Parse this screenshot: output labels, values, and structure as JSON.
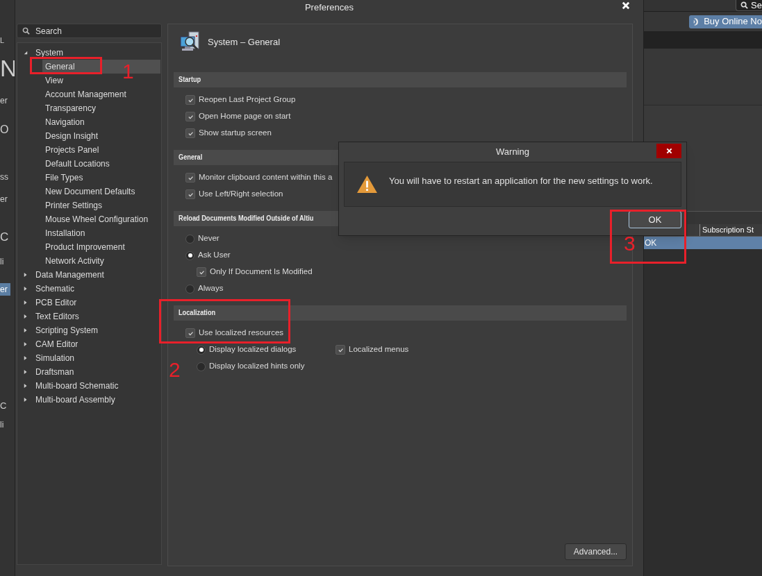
{
  "background_app": {
    "left_fragments": [
      {
        "text": "L",
        "selected": false
      },
      {
        "text": "N",
        "selected": false
      },
      {
        "text": "er",
        "selected": false
      },
      {
        "text": "O",
        "selected": false
      },
      {
        "text": "ss",
        "selected": false
      },
      {
        "text": "er",
        "selected": false
      },
      {
        "text": "C",
        "selected": false
      },
      {
        "text": "li",
        "selected": false
      },
      {
        "text": "er",
        "selected": true
      },
      {
        "text": "C",
        "selected": false
      },
      {
        "text": "li",
        "selected": false
      }
    ],
    "search": "Se",
    "buy_button": "Buy Online No",
    "table_header": "Subscription St",
    "table_cell": "OK"
  },
  "preferences": {
    "title": "Preferences",
    "search_placeholder": "Search",
    "tree": [
      {
        "label": "System",
        "expanded": true,
        "selected": false,
        "children": [
          {
            "label": "General",
            "selected": true
          },
          {
            "label": "View",
            "selected": false
          },
          {
            "label": "Account Management",
            "selected": false
          },
          {
            "label": "Transparency",
            "selected": false
          },
          {
            "label": "Navigation",
            "selected": false
          },
          {
            "label": "Design Insight",
            "selected": false
          },
          {
            "label": "Projects Panel",
            "selected": false
          },
          {
            "label": "Default Locations",
            "selected": false
          },
          {
            "label": "File Types",
            "selected": false
          },
          {
            "label": "New Document Defaults",
            "selected": false
          },
          {
            "label": "Printer Settings",
            "selected": false
          },
          {
            "label": "Mouse Wheel Configuration",
            "selected": false
          },
          {
            "label": "Installation",
            "selected": false
          },
          {
            "label": "Product Improvement",
            "selected": false
          },
          {
            "label": "Network Activity",
            "selected": false
          }
        ]
      },
      {
        "label": "Data Management",
        "expanded": false,
        "selected": false
      },
      {
        "label": "Schematic",
        "expanded": false,
        "selected": false
      },
      {
        "label": "PCB Editor",
        "expanded": false,
        "selected": false
      },
      {
        "label": "Text Editors",
        "expanded": false,
        "selected": false
      },
      {
        "label": "Scripting System",
        "expanded": false,
        "selected": false
      },
      {
        "label": "CAM Editor",
        "expanded": false,
        "selected": false
      },
      {
        "label": "Simulation",
        "expanded": false,
        "selected": false
      },
      {
        "label": "Draftsman",
        "expanded": false,
        "selected": false
      },
      {
        "label": "Multi-board Schematic",
        "expanded": false,
        "selected": false
      },
      {
        "label": "Multi-board Assembly",
        "expanded": false,
        "selected": false
      }
    ],
    "page_title": "System – General",
    "sections": [
      {
        "title": "Startup",
        "options": [
          {
            "kind": "checkbox",
            "label": "Reopen Last Project Group",
            "checked": true
          },
          {
            "kind": "checkbox",
            "label": "Open Home page on start",
            "checked": true
          },
          {
            "kind": "checkbox",
            "label": "Show startup screen",
            "checked": true
          }
        ]
      },
      {
        "title": "General",
        "options": [
          {
            "kind": "checkbox",
            "label": "Monitor clipboard content within this a",
            "checked": true
          },
          {
            "kind": "checkbox",
            "label": "Use Left/Right selection",
            "checked": true
          }
        ]
      },
      {
        "title": "Reload Documents Modified Outside of Altiu",
        "options": [
          {
            "kind": "radio",
            "label": "Never",
            "selected": false
          },
          {
            "kind": "radio",
            "label": "Ask User",
            "selected": true,
            "children": [
              {
                "kind": "checkbox",
                "label": "Only If Document Is Modified",
                "checked": true
              }
            ]
          },
          {
            "kind": "radio",
            "label": "Always",
            "selected": false
          }
        ]
      },
      {
        "title": "Localization",
        "options": [
          {
            "kind": "checkbox",
            "label": "Use localized resources",
            "checked": true,
            "children": [
              {
                "kind": "radio",
                "label": "Display localized dialogs",
                "selected": true,
                "aside": {
                  "kind": "checkbox",
                  "label": "Localized menus",
                  "checked": true
                }
              },
              {
                "kind": "radio",
                "label": "Display localized hints only",
                "selected": false
              }
            ]
          }
        ]
      }
    ],
    "advanced_button": "Advanced..."
  },
  "warning": {
    "title": "Warning",
    "message": "You will have to restart an application for the new settings to work.",
    "ok_button": "OK"
  },
  "annotations": [
    {
      "label": "1"
    },
    {
      "label": "2"
    },
    {
      "label": "3"
    }
  ]
}
